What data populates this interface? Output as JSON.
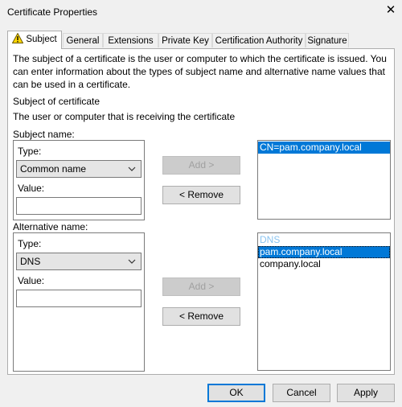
{
  "window": {
    "title": "Certificate Properties",
    "close_glyph": "✕"
  },
  "tabs": [
    {
      "label": "Subject",
      "active": true
    },
    {
      "label": "General"
    },
    {
      "label": "Extensions"
    },
    {
      "label": "Private Key"
    },
    {
      "label": "Certification Authority"
    },
    {
      "label": "Signature"
    }
  ],
  "subject_tab": {
    "intro": "The subject of a certificate is the user or computer to which the certificate is issued. You can enter information about the types of subject name and alternative name values that can be used in a certificate.",
    "subject_heading": "Subject of certificate",
    "subject_desc": "The user or computer that is receiving the certificate",
    "subject_name": {
      "label": "Subject name:",
      "type_label": "Type:",
      "type_value": "Common name",
      "value_label": "Value:",
      "value": "",
      "add_button": "Add >",
      "remove_button": "< Remove",
      "list": [
        "CN=pam.company.local"
      ]
    },
    "alternative_name": {
      "label": "Alternative name:",
      "type_label": "Type:",
      "type_value": "DNS",
      "value_label": "Value:",
      "value": "",
      "add_button": "Add >",
      "remove_button": "< Remove",
      "list_header": "DNS",
      "list": [
        "pam.company.local",
        "company.local"
      ]
    }
  },
  "footer": {
    "ok": "OK",
    "cancel": "Cancel",
    "apply": "Apply"
  },
  "icons": {
    "warning": "warning-icon",
    "dropdown": "chevron-down-icon"
  },
  "colors": {
    "selection": "#0078d7",
    "focus_border": "#0078d7",
    "warning": "#ffd700"
  }
}
